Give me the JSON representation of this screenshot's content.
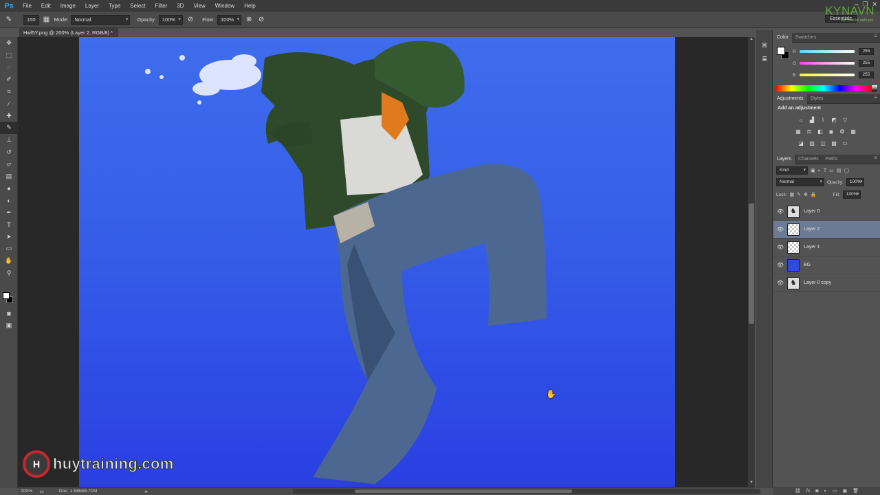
{
  "app": {
    "logo": "Ps"
  },
  "menu": [
    "File",
    "Edit",
    "Image",
    "Layer",
    "Type",
    "Select",
    "Filter",
    "3D",
    "View",
    "Window",
    "Help"
  ],
  "window_controls": [
    "–",
    "❐",
    "✕"
  ],
  "options_bar": {
    "brush_size": "150",
    "mode_label": "Mode:",
    "mode_value": "Normal",
    "opacity_label": "Opacity:",
    "opacity_value": "100%",
    "flow_label": "Flow:",
    "flow_value": "100%",
    "workspace": "Essentials"
  },
  "brand": {
    "name": "KYNAVN",
    "tagline": "Học thiết kế miễn phí"
  },
  "document": {
    "tab_title": "Hwl5Y.png @ 200% (Layer 2, RGB/8) *"
  },
  "tools": [
    "move",
    "marquee",
    "lasso",
    "quick-select",
    "crop",
    "eyedropper",
    "healing",
    "brush",
    "stamp",
    "history-brush",
    "eraser",
    "gradient",
    "blur",
    "dodge",
    "pen",
    "type",
    "path-select",
    "shape",
    "hand",
    "zoom"
  ],
  "status": {
    "zoom": "200%",
    "doc_info": "Doc: 1.58M/6.71M"
  },
  "color_panel": {
    "tabs": [
      "Color",
      "Swatches"
    ],
    "channels": [
      {
        "label": "R",
        "value": "255",
        "color": "#5fe1f2"
      },
      {
        "label": "G",
        "value": "255",
        "color": "#e84fe0"
      },
      {
        "label": "B",
        "value": "255",
        "color": "#f4f23b"
      }
    ]
  },
  "adjustments_panel": {
    "tabs": [
      "Adjustments",
      "Styles"
    ],
    "title": "Add an adjustment"
  },
  "layers_panel": {
    "tabs": [
      "Layers",
      "Channels",
      "Paths"
    ],
    "filter_kind": "Kind",
    "blend_mode": "Normal",
    "opacity_label": "Opacity:",
    "opacity_value": "100%",
    "lock_label": "Lock:",
    "fill_label": "Fill:",
    "fill_value": "100%",
    "layers": [
      {
        "name": "Layer 0",
        "thumb": "image",
        "selected": false
      },
      {
        "name": "Layer 2",
        "thumb": "transparent",
        "selected": true
      },
      {
        "name": "Layer 1",
        "thumb": "transparent",
        "selected": false
      },
      {
        "name": "BG",
        "thumb": "blue",
        "selected": false
      },
      {
        "name": "Layer 0 copy",
        "thumb": "image",
        "selected": false
      }
    ]
  },
  "watermark": {
    "logo_letter": "H",
    "text": "huytraining.com"
  },
  "colors": {
    "canvas_top": "#3f6cec",
    "canvas_bottom": "#2a3fe2",
    "selection": "#6d7a93",
    "brand": "#5fa83a"
  }
}
